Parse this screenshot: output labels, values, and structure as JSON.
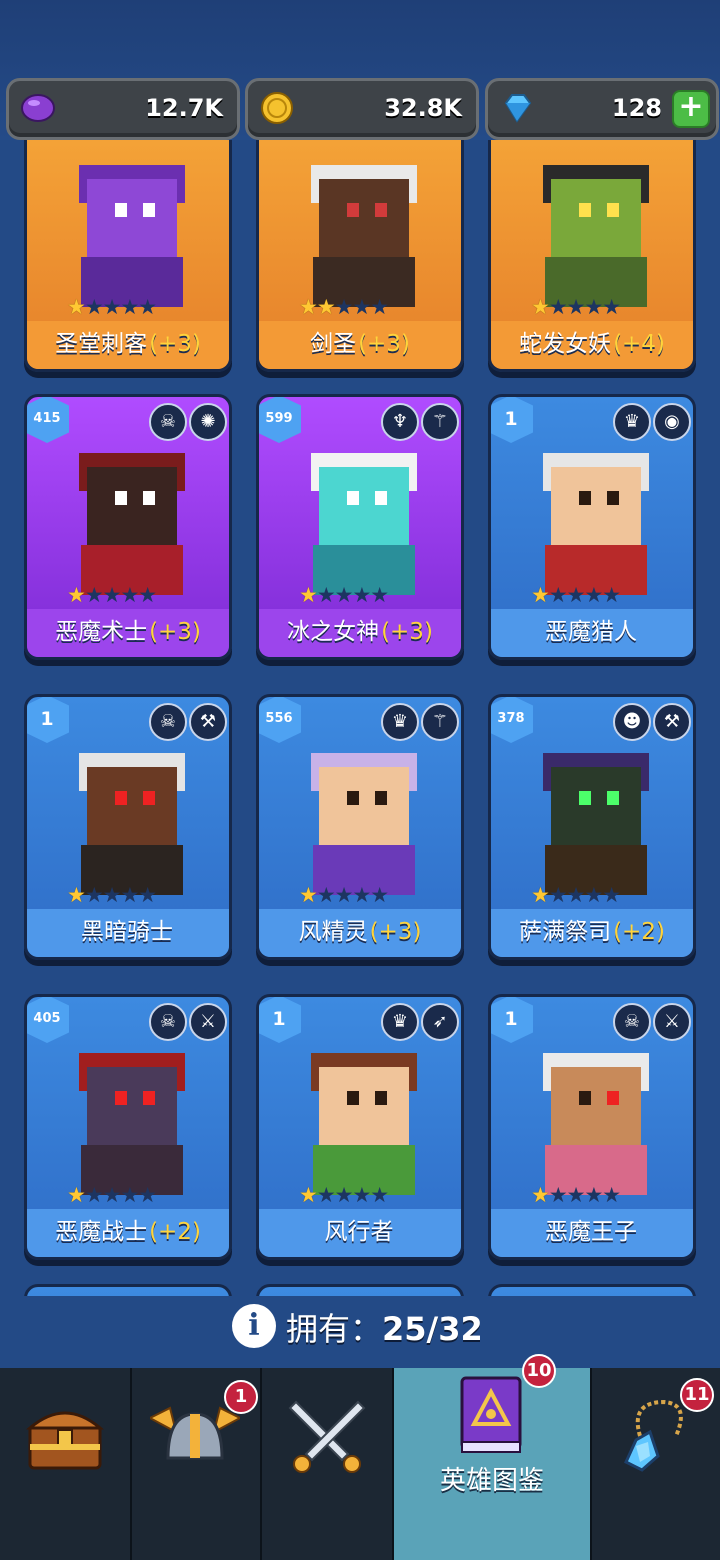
{
  "resources": {
    "gems_purple": "12.7K",
    "coins": "32.8K",
    "diamonds": "128",
    "add_label": "+"
  },
  "heroes": [
    {
      "name": "圣堂刺客",
      "bonus": "(+3)",
      "stars": 1,
      "level": "",
      "color": "orange"
    },
    {
      "name": "剑圣",
      "bonus": "(+3)",
      "stars": 2,
      "level": "",
      "color": "orange"
    },
    {
      "name": "蛇发女妖",
      "bonus": "(+4)",
      "stars": 1,
      "level": "",
      "color": "orange"
    },
    {
      "name": "恶魔术士",
      "bonus": "(+3)",
      "stars": 1,
      "level": "415",
      "color": "purple"
    },
    {
      "name": "冰之女神",
      "bonus": "(+3)",
      "stars": 1,
      "level": "599",
      "color": "purple"
    },
    {
      "name": "恶魔猎人",
      "bonus": "",
      "stars": 1,
      "level": "1",
      "color": "blue"
    },
    {
      "name": "黑暗骑士",
      "bonus": "",
      "stars": 1,
      "level": "1",
      "color": "blue"
    },
    {
      "name": "风精灵",
      "bonus": "(+3)",
      "stars": 1,
      "level": "556",
      "color": "blue"
    },
    {
      "name": "萨满祭司",
      "bonus": "(+2)",
      "stars": 1,
      "level": "378",
      "color": "blue"
    },
    {
      "name": "恶魔战士",
      "bonus": "(+2)",
      "stars": 1,
      "level": "405",
      "color": "blue"
    },
    {
      "name": "风行者",
      "bonus": "",
      "stars": 1,
      "level": "1",
      "color": "blue"
    },
    {
      "name": "恶魔王子",
      "bonus": "",
      "stars": 1,
      "level": "1",
      "color": "blue"
    }
  ],
  "owned": {
    "label": "拥有：",
    "value": "25/32"
  },
  "nav": {
    "tabs": [
      {
        "id": "chest",
        "icon": "treasure-chest-icon",
        "badge": ""
      },
      {
        "id": "heroes",
        "icon": "viking-helmet-icon",
        "badge": "1"
      },
      {
        "id": "battle",
        "icon": "crossed-swords-icon",
        "badge": ""
      },
      {
        "id": "codex",
        "icon": "spell-book-icon",
        "badge": "10",
        "label": "英雄图鉴"
      },
      {
        "id": "amulet",
        "icon": "amulet-icon",
        "badge": "11"
      }
    ]
  }
}
